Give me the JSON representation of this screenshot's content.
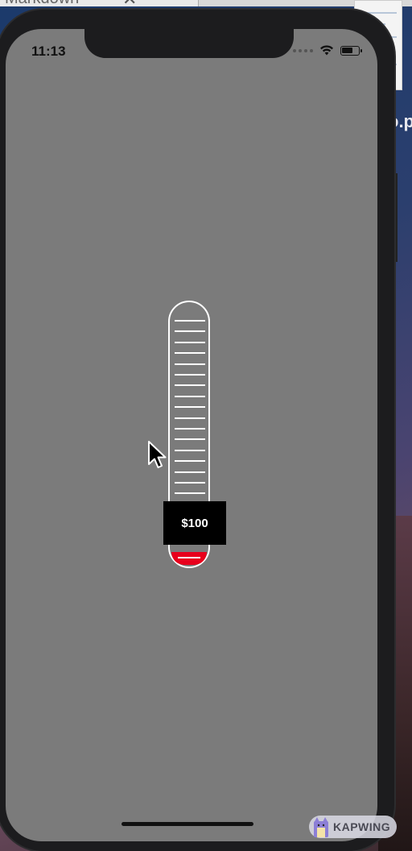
{
  "desktop": {
    "tab_title": "Markdown",
    "tab_close_glyph": "✕",
    "side_text": "o.p"
  },
  "status_bar": {
    "time": "11:13",
    "wifi_icon": "wifi-icon",
    "battery_icon": "battery-icon"
  },
  "thermometer": {
    "value_label": "$100",
    "fill_fraction": 0.05,
    "tick_count": 19,
    "fill_color": "#e8001c",
    "outline_color": "#ffffff"
  },
  "watermark": {
    "text": "KAPWING"
  },
  "colors": {
    "screen_background": "#7b7b7b",
    "phone_frame": "#1c1c1e"
  }
}
